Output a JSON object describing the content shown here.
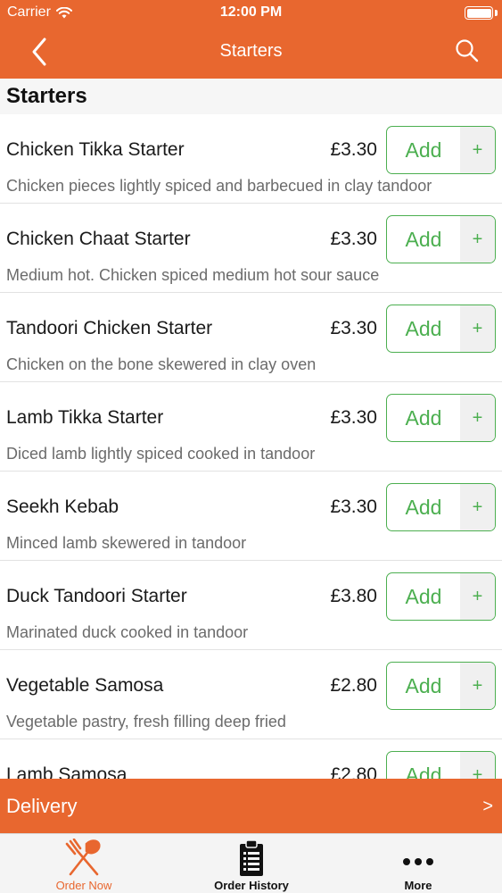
{
  "status_bar": {
    "carrier": "Carrier",
    "time": "12:00 PM",
    "wifi_icon": "wifi-icon",
    "battery_icon": "battery-icon"
  },
  "nav": {
    "title": "Starters",
    "back_icon": "chevron-left-icon",
    "search_icon": "search-icon"
  },
  "section": {
    "title": "Starters"
  },
  "add_button": {
    "label": "Add",
    "plus": "+"
  },
  "items": [
    {
      "name": "Chicken Tikka Starter",
      "price": "£3.30",
      "description": "Chicken pieces lightly spiced and barbecued in clay tandoor"
    },
    {
      "name": "Chicken Chaat Starter",
      "price": "£3.30",
      "description": "Medium hot. Chicken spiced medium hot sour sauce"
    },
    {
      "name": "Tandoori Chicken Starter",
      "price": "£3.30",
      "description": "Chicken on the bone skewered in clay oven"
    },
    {
      "name": "Lamb Tikka Starter",
      "price": "£3.30",
      "description": "Diced lamb lightly spiced cooked in tandoor"
    },
    {
      "name": "Seekh Kebab",
      "price": "£3.30",
      "description": "Minced lamb skewered in tandoor"
    },
    {
      "name": "Duck Tandoori Starter",
      "price": "£3.80",
      "description": "Marinated duck cooked in tandoor"
    },
    {
      "name": "Vegetable Samosa",
      "price": "£2.80",
      "description": "Vegetable pastry, fresh filling deep fried"
    },
    {
      "name": "Lamb Samosa",
      "price": "£2.80",
      "description": ""
    }
  ],
  "delivery": {
    "label": "Delivery",
    "arrow": ">"
  },
  "tabs": [
    {
      "label": "Order Now",
      "icon": "fork-knife-icon",
      "active": true
    },
    {
      "label": "Order History",
      "icon": "clipboard-icon",
      "active": false
    },
    {
      "label": "More",
      "icon": "more-dots-icon",
      "active": false
    }
  ],
  "colors": {
    "brand": "#e8672f",
    "accent_green": "#4caf50",
    "text": "#1a1a1a",
    "muted": "#6b6b6b"
  }
}
